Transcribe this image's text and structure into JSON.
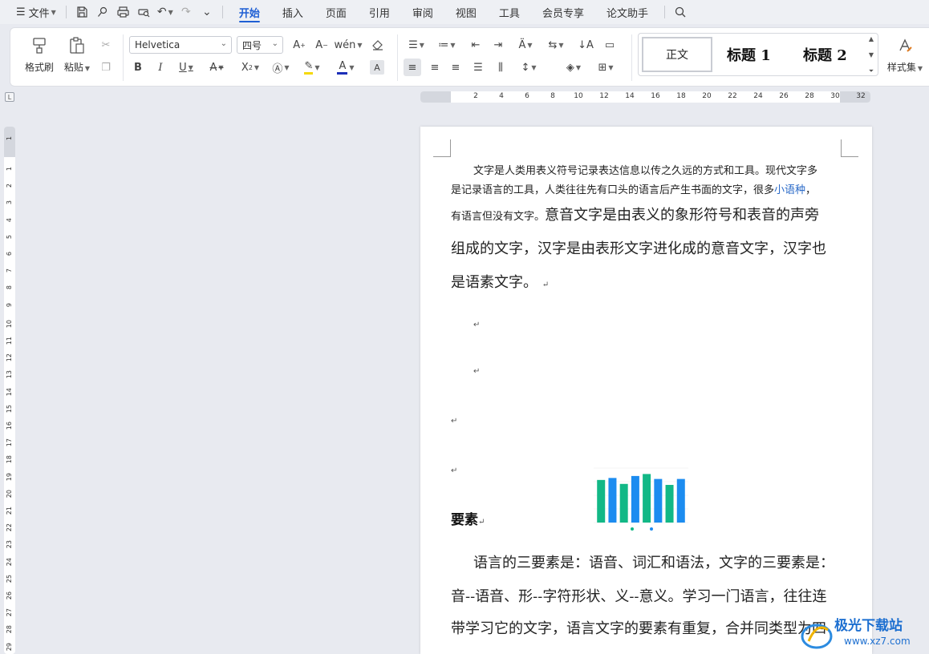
{
  "menubar": {
    "file_label": "文件",
    "tabs": [
      {
        "label": "开始",
        "active": true
      },
      {
        "label": "插入"
      },
      {
        "label": "页面"
      },
      {
        "label": "引用"
      },
      {
        "label": "审阅"
      },
      {
        "label": "视图"
      },
      {
        "label": "工具"
      },
      {
        "label": "会员专享"
      },
      {
        "label": "论文助手"
      }
    ]
  },
  "ribbon": {
    "format_painter": "格式刷",
    "paste": "粘贴",
    "font_name": "Helvetica",
    "font_size": "四号",
    "styles": {
      "normal": "正文",
      "h1": "标题 1",
      "h2": "标题 2",
      "more": "样式集"
    }
  },
  "rulers": {
    "horizontal_ticks": [
      "2",
      "4",
      "6",
      "8",
      "10",
      "12",
      "14",
      "16",
      "18",
      "20",
      "22",
      "24",
      "26",
      "28",
      "30",
      "32"
    ],
    "vertical_ticks": [
      "1",
      "1",
      "2",
      "3",
      "4",
      "5",
      "6",
      "7",
      "8",
      "9",
      "10",
      "11",
      "12",
      "13",
      "14",
      "15",
      "16",
      "17",
      "18",
      "19",
      "20",
      "21",
      "22",
      "23",
      "24",
      "25",
      "26",
      "27",
      "28",
      "29"
    ]
  },
  "document": {
    "p1_line1": "文字是人类用表义符号记录表达信息以传之久远的方式和工具。现代文字多",
    "p1_line2a": "是记录语言的工具，人类往往先有口头的语言后产生书面的文字，很多",
    "p1_line2_link": "小语种",
    "p1_line2b": "，",
    "p1_line3a": "有语言但没有文字。",
    "p1_line3b": "意音文字是由表义的象形符号和表音的声旁",
    "p1_line4": "组成的文字，汉字是由表形文字进化成的意音文字，汉字也",
    "p1_line5": "是语素文字。",
    "return_mark": "↵",
    "heading": "要素",
    "p2_line1": "语言的三要素是：语音、词汇和语法，文字的三要素是：",
    "p2_line2": "音--语音、形--字符形状、义--意义。学习一门语言，往往连",
    "p2_line3": "带学习它的文字，语言文字的要素有重复，合并同类型为四"
  },
  "colors": {
    "accent": "#1f5fd4",
    "bar_green": "#12b886",
    "bar_blue": "#1c8cf0"
  },
  "chart_data": {
    "type": "bar",
    "categories": [
      "",
      "",
      "",
      "",
      "",
      "",
      "",
      ""
    ],
    "values": [
      86,
      90,
      78,
      94,
      98,
      88,
      76,
      88
    ],
    "ylim": [
      0,
      110
    ],
    "series_colors": [
      "#12b886",
      "#1c8cf0",
      "#12b886",
      "#1c8cf0",
      "#12b886",
      "#1c8cf0",
      "#12b886",
      "#1c8cf0"
    ],
    "grid": true
  },
  "watermark": {
    "site": "极光下载站",
    "url": "www.xz7.com"
  }
}
